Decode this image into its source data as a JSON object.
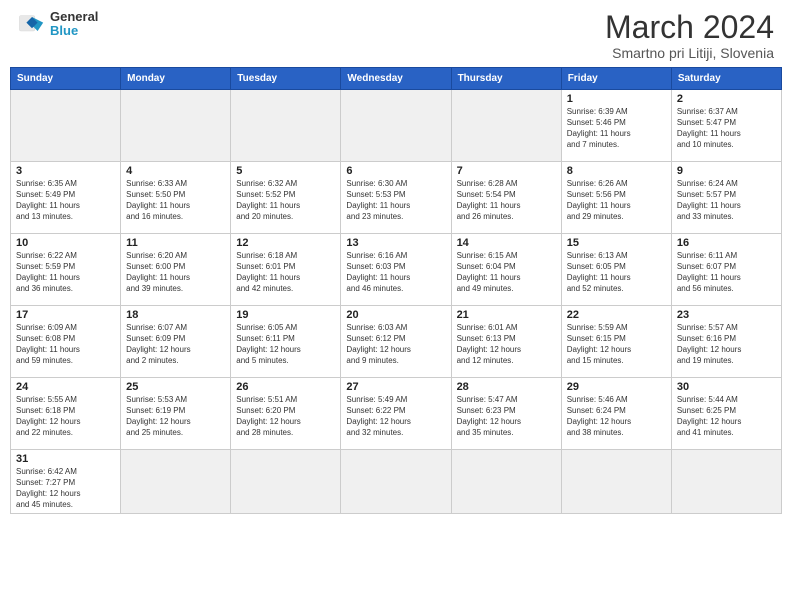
{
  "header": {
    "logo": {
      "general": "General",
      "blue": "Blue"
    },
    "title": "March 2024",
    "location": "Smartno pri Litiji, Slovenia"
  },
  "calendar": {
    "days_of_week": [
      "Sunday",
      "Monday",
      "Tuesday",
      "Wednesday",
      "Thursday",
      "Friday",
      "Saturday"
    ],
    "weeks": [
      [
        {
          "day": "",
          "info": "",
          "empty": true
        },
        {
          "day": "",
          "info": "",
          "empty": true
        },
        {
          "day": "",
          "info": "",
          "empty": true
        },
        {
          "day": "",
          "info": "",
          "empty": true
        },
        {
          "day": "",
          "info": "",
          "empty": true
        },
        {
          "day": "1",
          "info": "Sunrise: 6:39 AM\nSunset: 5:46 PM\nDaylight: 11 hours\nand 7 minutes.",
          "empty": false
        },
        {
          "day": "2",
          "info": "Sunrise: 6:37 AM\nSunset: 5:47 PM\nDaylight: 11 hours\nand 10 minutes.",
          "empty": false
        }
      ],
      [
        {
          "day": "3",
          "info": "Sunrise: 6:35 AM\nSunset: 5:49 PM\nDaylight: 11 hours\nand 13 minutes.",
          "empty": false
        },
        {
          "day": "4",
          "info": "Sunrise: 6:33 AM\nSunset: 5:50 PM\nDaylight: 11 hours\nand 16 minutes.",
          "empty": false
        },
        {
          "day": "5",
          "info": "Sunrise: 6:32 AM\nSunset: 5:52 PM\nDaylight: 11 hours\nand 20 minutes.",
          "empty": false
        },
        {
          "day": "6",
          "info": "Sunrise: 6:30 AM\nSunset: 5:53 PM\nDaylight: 11 hours\nand 23 minutes.",
          "empty": false
        },
        {
          "day": "7",
          "info": "Sunrise: 6:28 AM\nSunset: 5:54 PM\nDaylight: 11 hours\nand 26 minutes.",
          "empty": false
        },
        {
          "day": "8",
          "info": "Sunrise: 6:26 AM\nSunset: 5:56 PM\nDaylight: 11 hours\nand 29 minutes.",
          "empty": false
        },
        {
          "day": "9",
          "info": "Sunrise: 6:24 AM\nSunset: 5:57 PM\nDaylight: 11 hours\nand 33 minutes.",
          "empty": false
        }
      ],
      [
        {
          "day": "10",
          "info": "Sunrise: 6:22 AM\nSunset: 5:59 PM\nDaylight: 11 hours\nand 36 minutes.",
          "empty": false
        },
        {
          "day": "11",
          "info": "Sunrise: 6:20 AM\nSunset: 6:00 PM\nDaylight: 11 hours\nand 39 minutes.",
          "empty": false
        },
        {
          "day": "12",
          "info": "Sunrise: 6:18 AM\nSunset: 6:01 PM\nDaylight: 11 hours\nand 42 minutes.",
          "empty": false
        },
        {
          "day": "13",
          "info": "Sunrise: 6:16 AM\nSunset: 6:03 PM\nDaylight: 11 hours\nand 46 minutes.",
          "empty": false
        },
        {
          "day": "14",
          "info": "Sunrise: 6:15 AM\nSunset: 6:04 PM\nDaylight: 11 hours\nand 49 minutes.",
          "empty": false
        },
        {
          "day": "15",
          "info": "Sunrise: 6:13 AM\nSunset: 6:05 PM\nDaylight: 11 hours\nand 52 minutes.",
          "empty": false
        },
        {
          "day": "16",
          "info": "Sunrise: 6:11 AM\nSunset: 6:07 PM\nDaylight: 11 hours\nand 56 minutes.",
          "empty": false
        }
      ],
      [
        {
          "day": "17",
          "info": "Sunrise: 6:09 AM\nSunset: 6:08 PM\nDaylight: 11 hours\nand 59 minutes.",
          "empty": false
        },
        {
          "day": "18",
          "info": "Sunrise: 6:07 AM\nSunset: 6:09 PM\nDaylight: 12 hours\nand 2 minutes.",
          "empty": false
        },
        {
          "day": "19",
          "info": "Sunrise: 6:05 AM\nSunset: 6:11 PM\nDaylight: 12 hours\nand 5 minutes.",
          "empty": false
        },
        {
          "day": "20",
          "info": "Sunrise: 6:03 AM\nSunset: 6:12 PM\nDaylight: 12 hours\nand 9 minutes.",
          "empty": false
        },
        {
          "day": "21",
          "info": "Sunrise: 6:01 AM\nSunset: 6:13 PM\nDaylight: 12 hours\nand 12 minutes.",
          "empty": false
        },
        {
          "day": "22",
          "info": "Sunrise: 5:59 AM\nSunset: 6:15 PM\nDaylight: 12 hours\nand 15 minutes.",
          "empty": false
        },
        {
          "day": "23",
          "info": "Sunrise: 5:57 AM\nSunset: 6:16 PM\nDaylight: 12 hours\nand 19 minutes.",
          "empty": false
        }
      ],
      [
        {
          "day": "24",
          "info": "Sunrise: 5:55 AM\nSunset: 6:18 PM\nDaylight: 12 hours\nand 22 minutes.",
          "empty": false
        },
        {
          "day": "25",
          "info": "Sunrise: 5:53 AM\nSunset: 6:19 PM\nDaylight: 12 hours\nand 25 minutes.",
          "empty": false
        },
        {
          "day": "26",
          "info": "Sunrise: 5:51 AM\nSunset: 6:20 PM\nDaylight: 12 hours\nand 28 minutes.",
          "empty": false
        },
        {
          "day": "27",
          "info": "Sunrise: 5:49 AM\nSunset: 6:22 PM\nDaylight: 12 hours\nand 32 minutes.",
          "empty": false
        },
        {
          "day": "28",
          "info": "Sunrise: 5:47 AM\nSunset: 6:23 PM\nDaylight: 12 hours\nand 35 minutes.",
          "empty": false
        },
        {
          "day": "29",
          "info": "Sunrise: 5:46 AM\nSunset: 6:24 PM\nDaylight: 12 hours\nand 38 minutes.",
          "empty": false
        },
        {
          "day": "30",
          "info": "Sunrise: 5:44 AM\nSunset: 6:25 PM\nDaylight: 12 hours\nand 41 minutes.",
          "empty": false
        }
      ],
      [
        {
          "day": "31",
          "info": "Sunrise: 6:42 AM\nSunset: 7:27 PM\nDaylight: 12 hours\nand 45 minutes.",
          "empty": false
        },
        {
          "day": "",
          "info": "",
          "empty": true
        },
        {
          "day": "",
          "info": "",
          "empty": true
        },
        {
          "day": "",
          "info": "",
          "empty": true
        },
        {
          "day": "",
          "info": "",
          "empty": true
        },
        {
          "day": "",
          "info": "",
          "empty": true
        },
        {
          "day": "",
          "info": "",
          "empty": true
        }
      ]
    ]
  }
}
